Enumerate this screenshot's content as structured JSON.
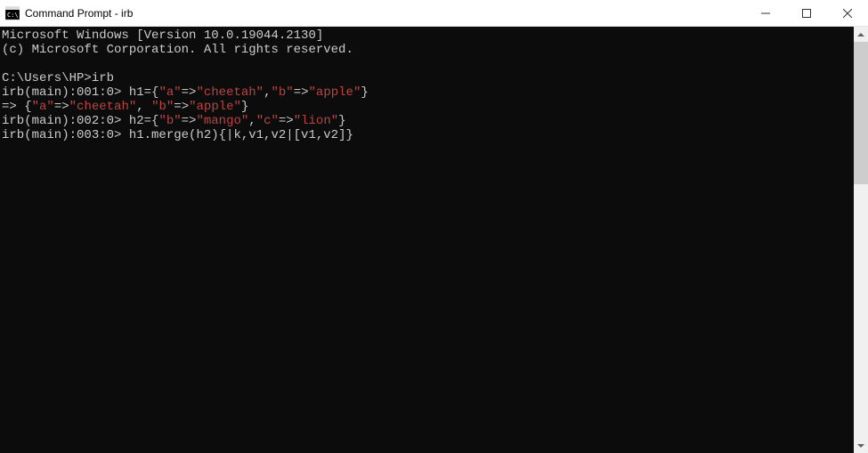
{
  "window": {
    "title": "Command Prompt - irb"
  },
  "terminal": {
    "line1": "Microsoft Windows [Version 10.0.19044.2130]",
    "line2": "(c) Microsoft Corporation. All rights reserved.",
    "prompt_path": "C:\\Users\\HP>",
    "cmd": "irb",
    "irb1_prompt": "irb(main):001:0> ",
    "irb1_a": "h1={",
    "irb1_s1": "\"a\"",
    "irb1_b": "=>",
    "irb1_s2": "\"cheetah\"",
    "irb1_c": ",",
    "irb1_s3": "\"b\"",
    "irb1_d": "=>",
    "irb1_s4": "\"apple\"",
    "irb1_e": "}",
    "out1_a": "=> {",
    "out1_s1": "\"a\"",
    "out1_b": "=>",
    "out1_s2": "\"cheetah\"",
    "out1_c": ", ",
    "out1_s3": "\"b\"",
    "out1_d": "=>",
    "out1_s4": "\"apple\"",
    "out1_e": "}",
    "irb2_prompt": "irb(main):002:0> ",
    "irb2_a": "h2={",
    "irb2_s1": "\"b\"",
    "irb2_b": "=>",
    "irb2_s2": "\"mango\"",
    "irb2_c": ",",
    "irb2_s3": "\"c\"",
    "irb2_d": "=>",
    "irb2_s4": "\"lion\"",
    "irb2_e": "}",
    "irb3_prompt": "irb(main):003:0> ",
    "irb3_cmd": "h1.merge(h2){|k,v1,v2|[v1,v2]}"
  }
}
